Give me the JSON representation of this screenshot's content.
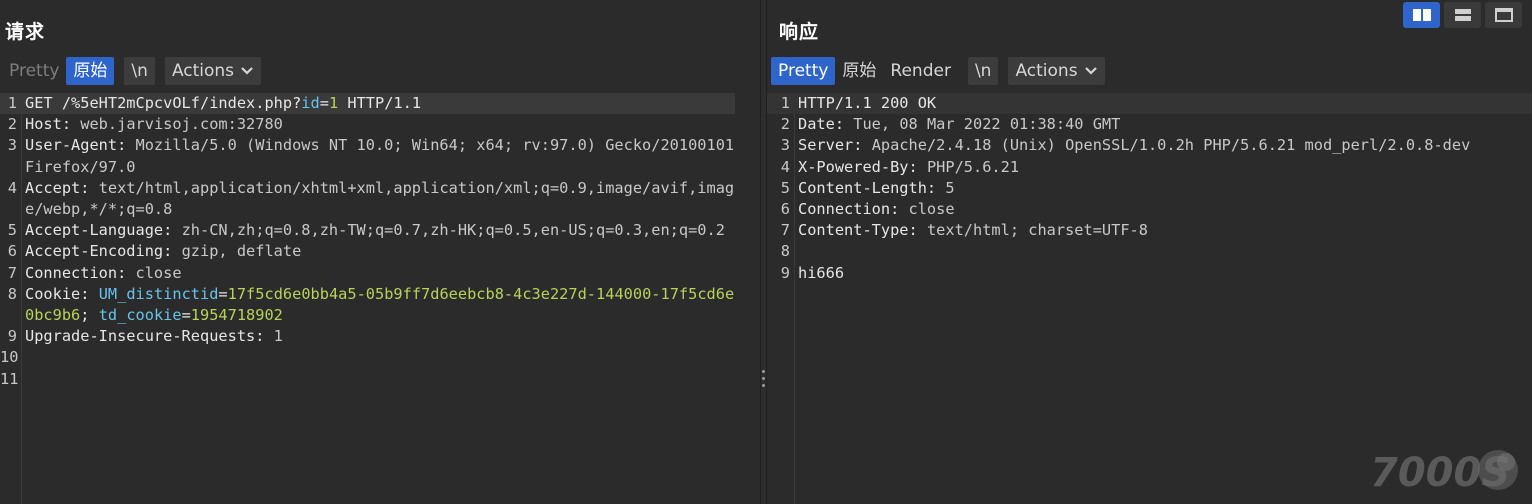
{
  "request": {
    "title": "请求",
    "toolbar": {
      "pretty": "Pretty",
      "raw": "原始",
      "newline": "\\n",
      "actions": "Actions"
    },
    "lines": [
      {
        "n": "1",
        "parts": [
          {
            "t": "GET /%5eHT2mCpcvOLf/index.php?",
            "c": "k"
          },
          {
            "t": "id",
            "c": "pn"
          },
          {
            "t": "=",
            "c": "k"
          },
          {
            "t": "1",
            "c": "pv"
          },
          {
            "t": " HTTP/1.1",
            "c": "k"
          }
        ]
      },
      {
        "n": "2",
        "parts": [
          {
            "t": "Host: ",
            "c": "k"
          },
          {
            "t": "web.jarvisoj.com:32780",
            "c": "v"
          }
        ]
      },
      {
        "n": "3",
        "parts": [
          {
            "t": "User-Agent: ",
            "c": "k"
          },
          {
            "t": "Mozilla/5.0 (Windows NT 10.0; Win64; x64; rv:97.0) Gecko/20100101 Firefox/97.0",
            "c": "v"
          }
        ]
      },
      {
        "n": "4",
        "parts": [
          {
            "t": "Accept: ",
            "c": "k"
          },
          {
            "t": "text/html,application/xhtml+xml,application/xml;q=0.9,image/avif,image/webp,*/*;q=0.8",
            "c": "v"
          }
        ]
      },
      {
        "n": "5",
        "parts": [
          {
            "t": "Accept-Language: ",
            "c": "k"
          },
          {
            "t": "zh-CN,zh;q=0.8,zh-TW;q=0.7,zh-HK;q=0.5,en-US;q=0.3,en;q=0.2",
            "c": "v"
          }
        ]
      },
      {
        "n": "6",
        "parts": [
          {
            "t": "Accept-Encoding: ",
            "c": "k"
          },
          {
            "t": "gzip, deflate",
            "c": "v"
          }
        ]
      },
      {
        "n": "7",
        "parts": [
          {
            "t": "Connection: ",
            "c": "k"
          },
          {
            "t": "close",
            "c": "v"
          }
        ]
      },
      {
        "n": "8",
        "parts": [
          {
            "t": "Cookie: ",
            "c": "k"
          },
          {
            "t": "UM_distinctid",
            "c": "ck"
          },
          {
            "t": "=",
            "c": "k"
          },
          {
            "t": "17f5cd6e0bb4a5-05b9ff7d6eebcb8-4c3e227d-144000-17f5cd6e0bc9b6",
            "c": "cv"
          },
          {
            "t": "; ",
            "c": "k"
          },
          {
            "t": "td_cookie",
            "c": "ck"
          },
          {
            "t": "=",
            "c": "k"
          },
          {
            "t": "1954718902",
            "c": "cv"
          }
        ]
      },
      {
        "n": "9",
        "parts": [
          {
            "t": "Upgrade-Insecure-Requests: ",
            "c": "k"
          },
          {
            "t": "1",
            "c": "v"
          }
        ]
      },
      {
        "n": "10",
        "parts": []
      },
      {
        "n": "11",
        "parts": []
      }
    ]
  },
  "response": {
    "title": "响应",
    "toolbar": {
      "pretty": "Pretty",
      "raw": "原始",
      "render": "Render",
      "newline": "\\n",
      "actions": "Actions"
    },
    "lines": [
      {
        "n": "1",
        "parts": [
          {
            "t": "HTTP/1.1 200 OK",
            "c": "k"
          }
        ]
      },
      {
        "n": "2",
        "parts": [
          {
            "t": "Date: ",
            "c": "k"
          },
          {
            "t": "Tue, 08 Mar 2022 01:38:40 GMT",
            "c": "v"
          }
        ]
      },
      {
        "n": "3",
        "parts": [
          {
            "t": "Server: ",
            "c": "k"
          },
          {
            "t": "Apache/2.4.18 (Unix) OpenSSL/1.0.2h PHP/5.6.21 mod_perl/2.0.8-dev",
            "c": "v"
          }
        ]
      },
      {
        "n": "4",
        "parts": [
          {
            "t": "X-Powered-By: ",
            "c": "k"
          },
          {
            "t": "PHP/5.6.21",
            "c": "v"
          }
        ]
      },
      {
        "n": "5",
        "parts": [
          {
            "t": "Content-Length: ",
            "c": "k"
          },
          {
            "t": "5",
            "c": "v"
          }
        ]
      },
      {
        "n": "6",
        "parts": [
          {
            "t": "Connection: ",
            "c": "k"
          },
          {
            "t": "close",
            "c": "v"
          }
        ]
      },
      {
        "n": "7",
        "parts": [
          {
            "t": "Content-Type: ",
            "c": "k"
          },
          {
            "t": "text/html; charset=UTF-8",
            "c": "v"
          }
        ]
      },
      {
        "n": "8",
        "parts": []
      },
      {
        "n": "9",
        "parts": [
          {
            "t": "hi666",
            "c": "k"
          }
        ]
      }
    ]
  },
  "view_switch": [
    {
      "name": "side-by-side-view-icon",
      "active": true
    },
    {
      "name": "stacked-view-icon",
      "active": false
    },
    {
      "name": "single-view-icon",
      "active": false
    }
  ],
  "watermark": {
    "text": "7000S"
  },
  "colors": {
    "background": "#2b2b2b",
    "accent": "#2f65ca",
    "param_name": "#67c3ea",
    "param_value": "#b6d35a"
  }
}
